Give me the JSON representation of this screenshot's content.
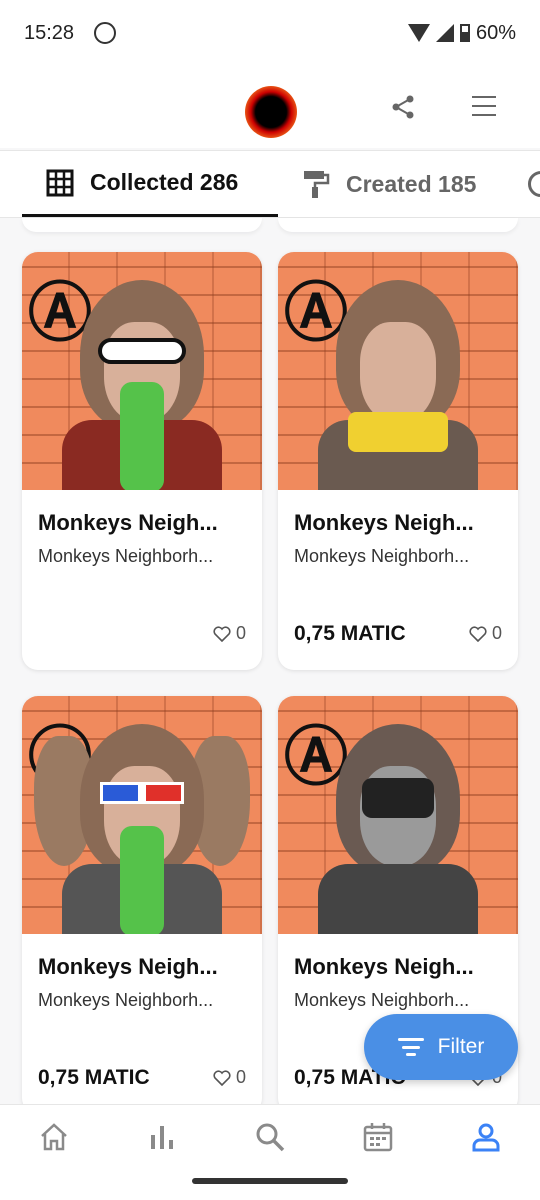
{
  "status_bar": {
    "time": "15:28",
    "battery": "60%"
  },
  "profile": {
    "avatar": "avatar"
  },
  "tabs": [
    {
      "label": "Collected 286",
      "icon": "grid-icon",
      "active": true
    },
    {
      "label": "Created 185",
      "icon": "paint-roller-icon",
      "active": false
    }
  ],
  "cards": [
    {
      "title": "Monkeys Neigh...",
      "subtitle": "Monkeys Neighborh...",
      "price": "",
      "likes": "0"
    },
    {
      "title": "Monkeys Neigh...",
      "subtitle": "Monkeys Neighborh...",
      "price": "0,75 MATIC",
      "likes": "0"
    },
    {
      "title": "Monkeys Neigh...",
      "subtitle": "Monkeys Neighborh...",
      "price": "0,75 MATIC",
      "likes": "0"
    },
    {
      "title": "Monkeys Neigh...",
      "subtitle": "Monkeys Neighborh...",
      "price": "0,75 MATIC",
      "likes": "0"
    }
  ],
  "filter": {
    "label": "Filter"
  },
  "bottom_nav": [
    "home-icon",
    "stats-icon",
    "search-icon",
    "calendar-icon",
    "profile-icon"
  ],
  "colors": {
    "accent": "#4a8fe5",
    "brick": "#f08a5d",
    "active_nav": "#3b82f6",
    "inactive_nav": "#8a8a8a"
  }
}
